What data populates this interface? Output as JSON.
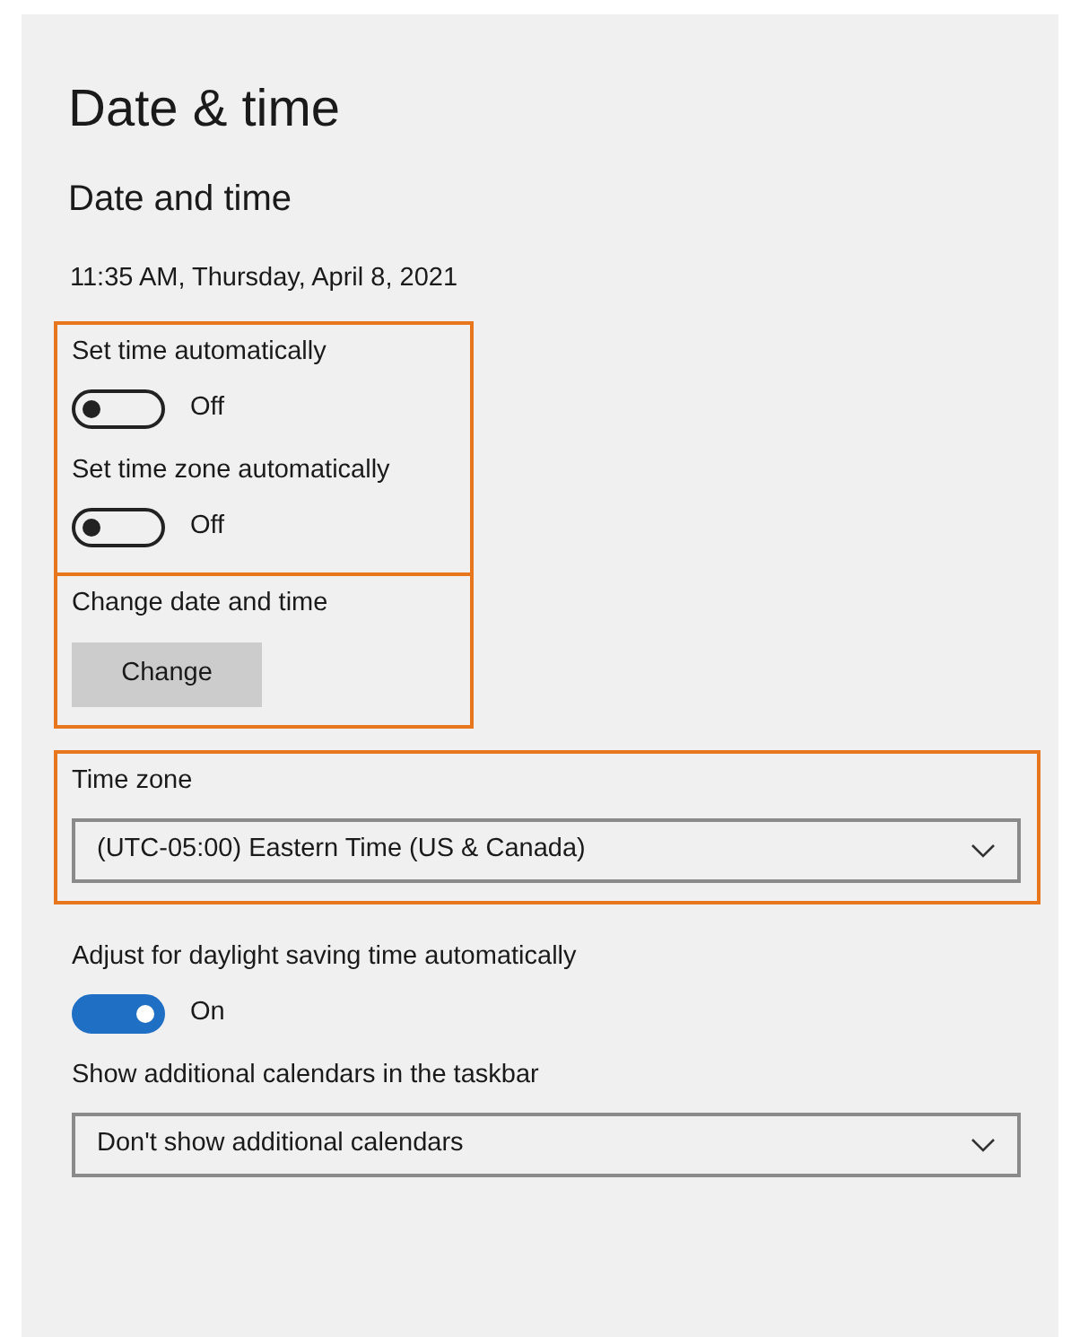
{
  "title": "Date & time",
  "subtitle": "Date and time",
  "current_time": "11:35 AM, Thursday, April 8, 2021",
  "sections": [
    {
      "highlighted": true,
      "items": [
        {
          "kind": "toggle",
          "label": "Set time automatically",
          "on": false,
          "state_text": "Off"
        },
        {
          "kind": "toggle",
          "label": "Set time zone automatically",
          "on": false,
          "state_text": "Off"
        }
      ]
    },
    {
      "highlighted": true,
      "items": [
        {
          "kind": "button",
          "label": "Change date and time",
          "button": "Change"
        }
      ]
    },
    {
      "highlighted": true,
      "items": [
        {
          "kind": "dropdown",
          "label": "Time zone",
          "value": "(UTC-05:00) Eastern Time (US & Canada)"
        }
      ]
    },
    {
      "highlighted": false,
      "items": [
        {
          "kind": "toggle",
          "label": "Adjust for daylight saving time automatically",
          "on": true,
          "state_text": "On"
        },
        {
          "kind": "dropdown",
          "label": "Show additional calendars in the taskbar",
          "value": "Don't show additional calendars"
        }
      ]
    }
  ]
}
